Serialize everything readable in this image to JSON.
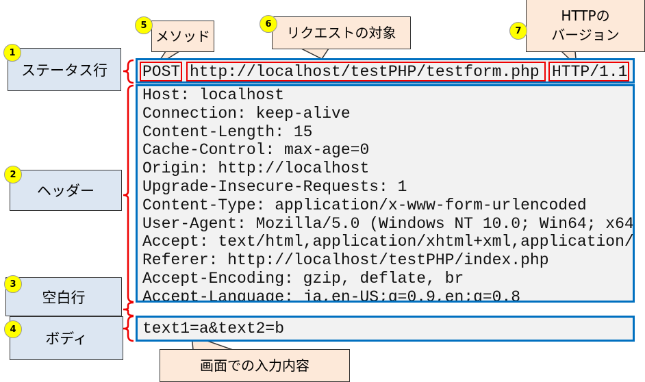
{
  "labels": [
    {
      "num": "1",
      "text": "ステータス行"
    },
    {
      "num": "2",
      "text": "ヘッダー"
    },
    {
      "num": "3",
      "text": "空白行"
    },
    {
      "num": "4",
      "text": "ボディ"
    }
  ],
  "callouts": {
    "method": {
      "num": "5",
      "text": "メソッド"
    },
    "target": {
      "num": "6",
      "text": "リクエストの対象"
    },
    "version": {
      "num": "7",
      "line1": "HTTPの",
      "line2": "バージョン"
    },
    "input": {
      "text": "画面での入力内容"
    }
  },
  "status_line": {
    "method": "POST",
    "url": "http://localhost/testPHP/testform.php",
    "version": "HTTP/1.1"
  },
  "headers": [
    "Host: localhost",
    "Connection: keep-alive",
    "Content-Length: 15",
    "Cache-Control: max-age=0",
    "Origin: http://localhost",
    "Upgrade-Insecure-Requests: 1",
    "Content-Type: application/x-www-form-urlencoded",
    "User-Agent: Mozilla/5.0 (Windows NT 10.0; Win64; x64",
    "Accept: text/html,application/xhtml+xml,application/",
    "Referer: http://localhost/testPHP/index.php",
    "Accept-Encoding: gzip, deflate, br",
    "Accept-Language: ja,en-US;q=0.9,en;q=0.8"
  ],
  "body": "text1=a&text2=b"
}
